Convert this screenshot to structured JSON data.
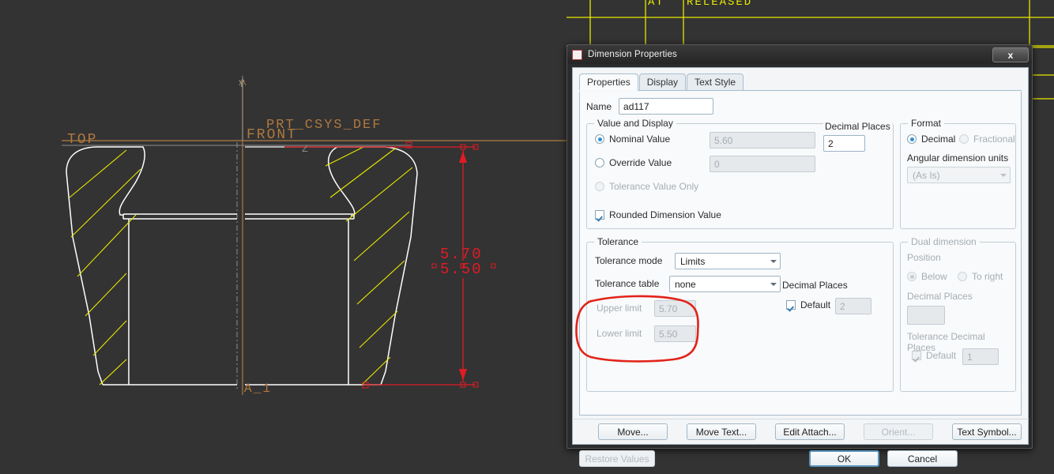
{
  "cad": {
    "background_color": "#333333",
    "labels": {
      "top": "TOP",
      "front": "FRONT",
      "csys": "PRT_CSYS_DEF",
      "axis_y": "Y",
      "axis_z": "Z",
      "axis_name": "A_1"
    },
    "dimension": {
      "upper": "5.70",
      "lower": "5.50",
      "color": "#e01b24"
    },
    "table_text": {
      "at": "AT",
      "released": "RELEASED"
    },
    "colors": {
      "hatch": "#e8e800",
      "outline": "#ffffff",
      "datum": "#b07840",
      "table": "#e8e800"
    }
  },
  "dialog": {
    "title": "Dimension Properties",
    "close_label": "x",
    "tabs": [
      {
        "label": "Properties",
        "active": true
      },
      {
        "label": "Display",
        "active": false
      },
      {
        "label": "Text Style",
        "active": false
      }
    ],
    "name": {
      "label": "Name",
      "value": "ad117"
    },
    "value_and_display": {
      "legend": "Value and Display",
      "nominal": {
        "label": "Nominal Value",
        "selected": true,
        "value": "5.60",
        "enabled": false
      },
      "override": {
        "label": "Override Value",
        "selected": false,
        "value": "0",
        "enabled": false
      },
      "tolerance_only": {
        "label": "Tolerance Value Only",
        "selected": false,
        "enabled": false
      },
      "decimal_places": {
        "label": "Decimal Places",
        "value": "2"
      },
      "rounded": {
        "label": "Rounded Dimension Value",
        "checked": true
      }
    },
    "format": {
      "legend": "Format",
      "decimal": {
        "label": "Decimal",
        "selected": true
      },
      "fractional": {
        "label": "Fractional",
        "selected": false
      },
      "angular_units_label": "Angular dimension units",
      "angular_units_value": "(As Is)"
    },
    "tolerance": {
      "legend": "Tolerance",
      "mode_label": "Tolerance mode",
      "mode_value": "Limits",
      "table_label": "Tolerance table",
      "table_value": "none",
      "upper_limit_label": "Upper limit",
      "upper_limit_value": "5.70",
      "lower_limit_label": "Lower limit",
      "lower_limit_value": "5.50",
      "decimal_places_label": "Decimal Places",
      "default_label": "Default",
      "default_checked": true,
      "default_value": "2"
    },
    "dual_dimension": {
      "legend": "Dual dimension",
      "position_label": "Position",
      "below": {
        "label": "Below",
        "selected": true
      },
      "to_right": {
        "label": "To right",
        "selected": false
      },
      "decimal_places_label": "Decimal Places",
      "decimal_places_value": "",
      "tolerance_decimal_places_label": "Tolerance Decimal Places",
      "default_label": "Default",
      "default_checked": true,
      "default_value": "1"
    },
    "action_buttons": [
      {
        "label": "Move...",
        "enabled": true
      },
      {
        "label": "Move Text...",
        "enabled": true
      },
      {
        "label": "Edit Attach...",
        "enabled": true
      },
      {
        "label": "Orient...",
        "enabled": false
      },
      {
        "label": "Text Symbol...",
        "enabled": true
      }
    ],
    "footer": {
      "restore": {
        "label": "Restore Values",
        "enabled": false
      },
      "ok": {
        "label": "OK",
        "default": true
      },
      "cancel": {
        "label": "Cancel"
      }
    }
  },
  "annotation": {
    "type": "hand-drawn-ellipse",
    "color": "#e2231a",
    "target": "tolerance-limits"
  }
}
